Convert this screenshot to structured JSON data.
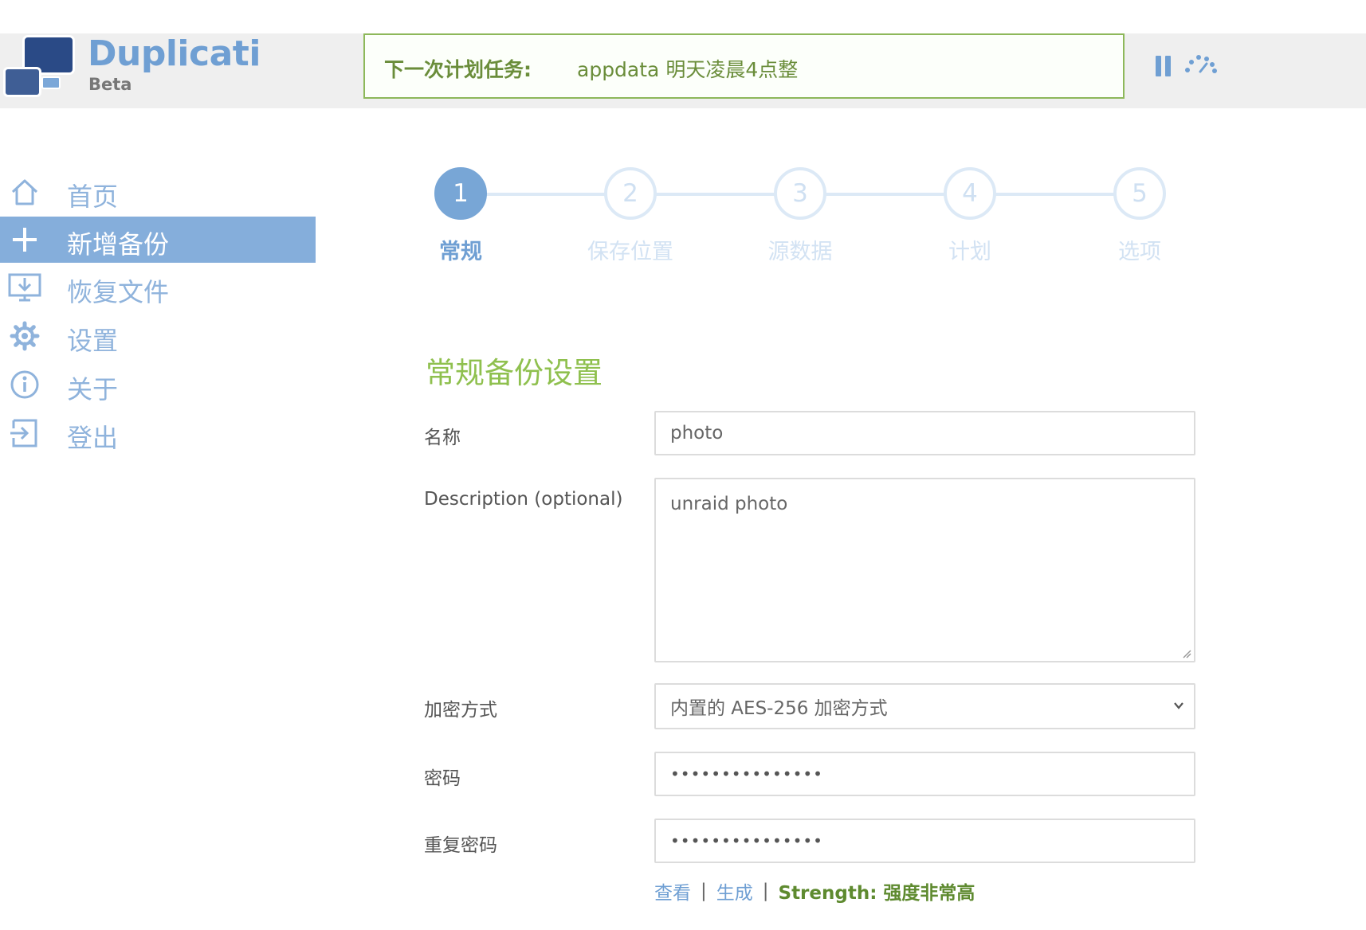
{
  "header": {
    "brand": "Duplicati",
    "brand_sub": "Beta",
    "status_label": "下一次计划任务:",
    "status_text": "appdata 明天凌晨4点整",
    "pause_icon": "pause-icon",
    "throttle_icon": "speed-icon"
  },
  "sidebar": {
    "items": [
      {
        "label": "首页",
        "icon": "home-icon"
      },
      {
        "label": "新增备份",
        "icon": "plus-icon",
        "active": true
      },
      {
        "label": "恢复文件",
        "icon": "restore-icon"
      },
      {
        "label": "设置",
        "icon": "gear-icon"
      },
      {
        "label": "关于",
        "icon": "info-icon"
      },
      {
        "label": "登出",
        "icon": "logout-icon"
      }
    ]
  },
  "steps": [
    {
      "number": "1",
      "label": "常规",
      "active": true
    },
    {
      "number": "2",
      "label": "保存位置"
    },
    {
      "number": "3",
      "label": "源数据"
    },
    {
      "number": "4",
      "label": "计划"
    },
    {
      "number": "5",
      "label": "选项"
    }
  ],
  "form": {
    "section_title": "常规备份设置",
    "name_label": "名称",
    "name_value": "photo",
    "description_label": "Description (optional)",
    "description_value": "unraid photo",
    "encryption_label": "加密方式",
    "encryption_value": "内置的 AES-256 加密方式",
    "password_label": "密码",
    "password_value": "•••••••••••••••",
    "repeat_password_label": "重复密码",
    "repeat_password_value": "•••••••••••••••",
    "show_link": "查看",
    "separator": "|",
    "generate_link": "生成",
    "strength_text": "Strength: 强度非常高"
  },
  "colors": {
    "accent_blue": "#6f9fd3",
    "active_nav": "#85aedb",
    "green": "#8fc04e",
    "status_border": "#8db85a"
  }
}
